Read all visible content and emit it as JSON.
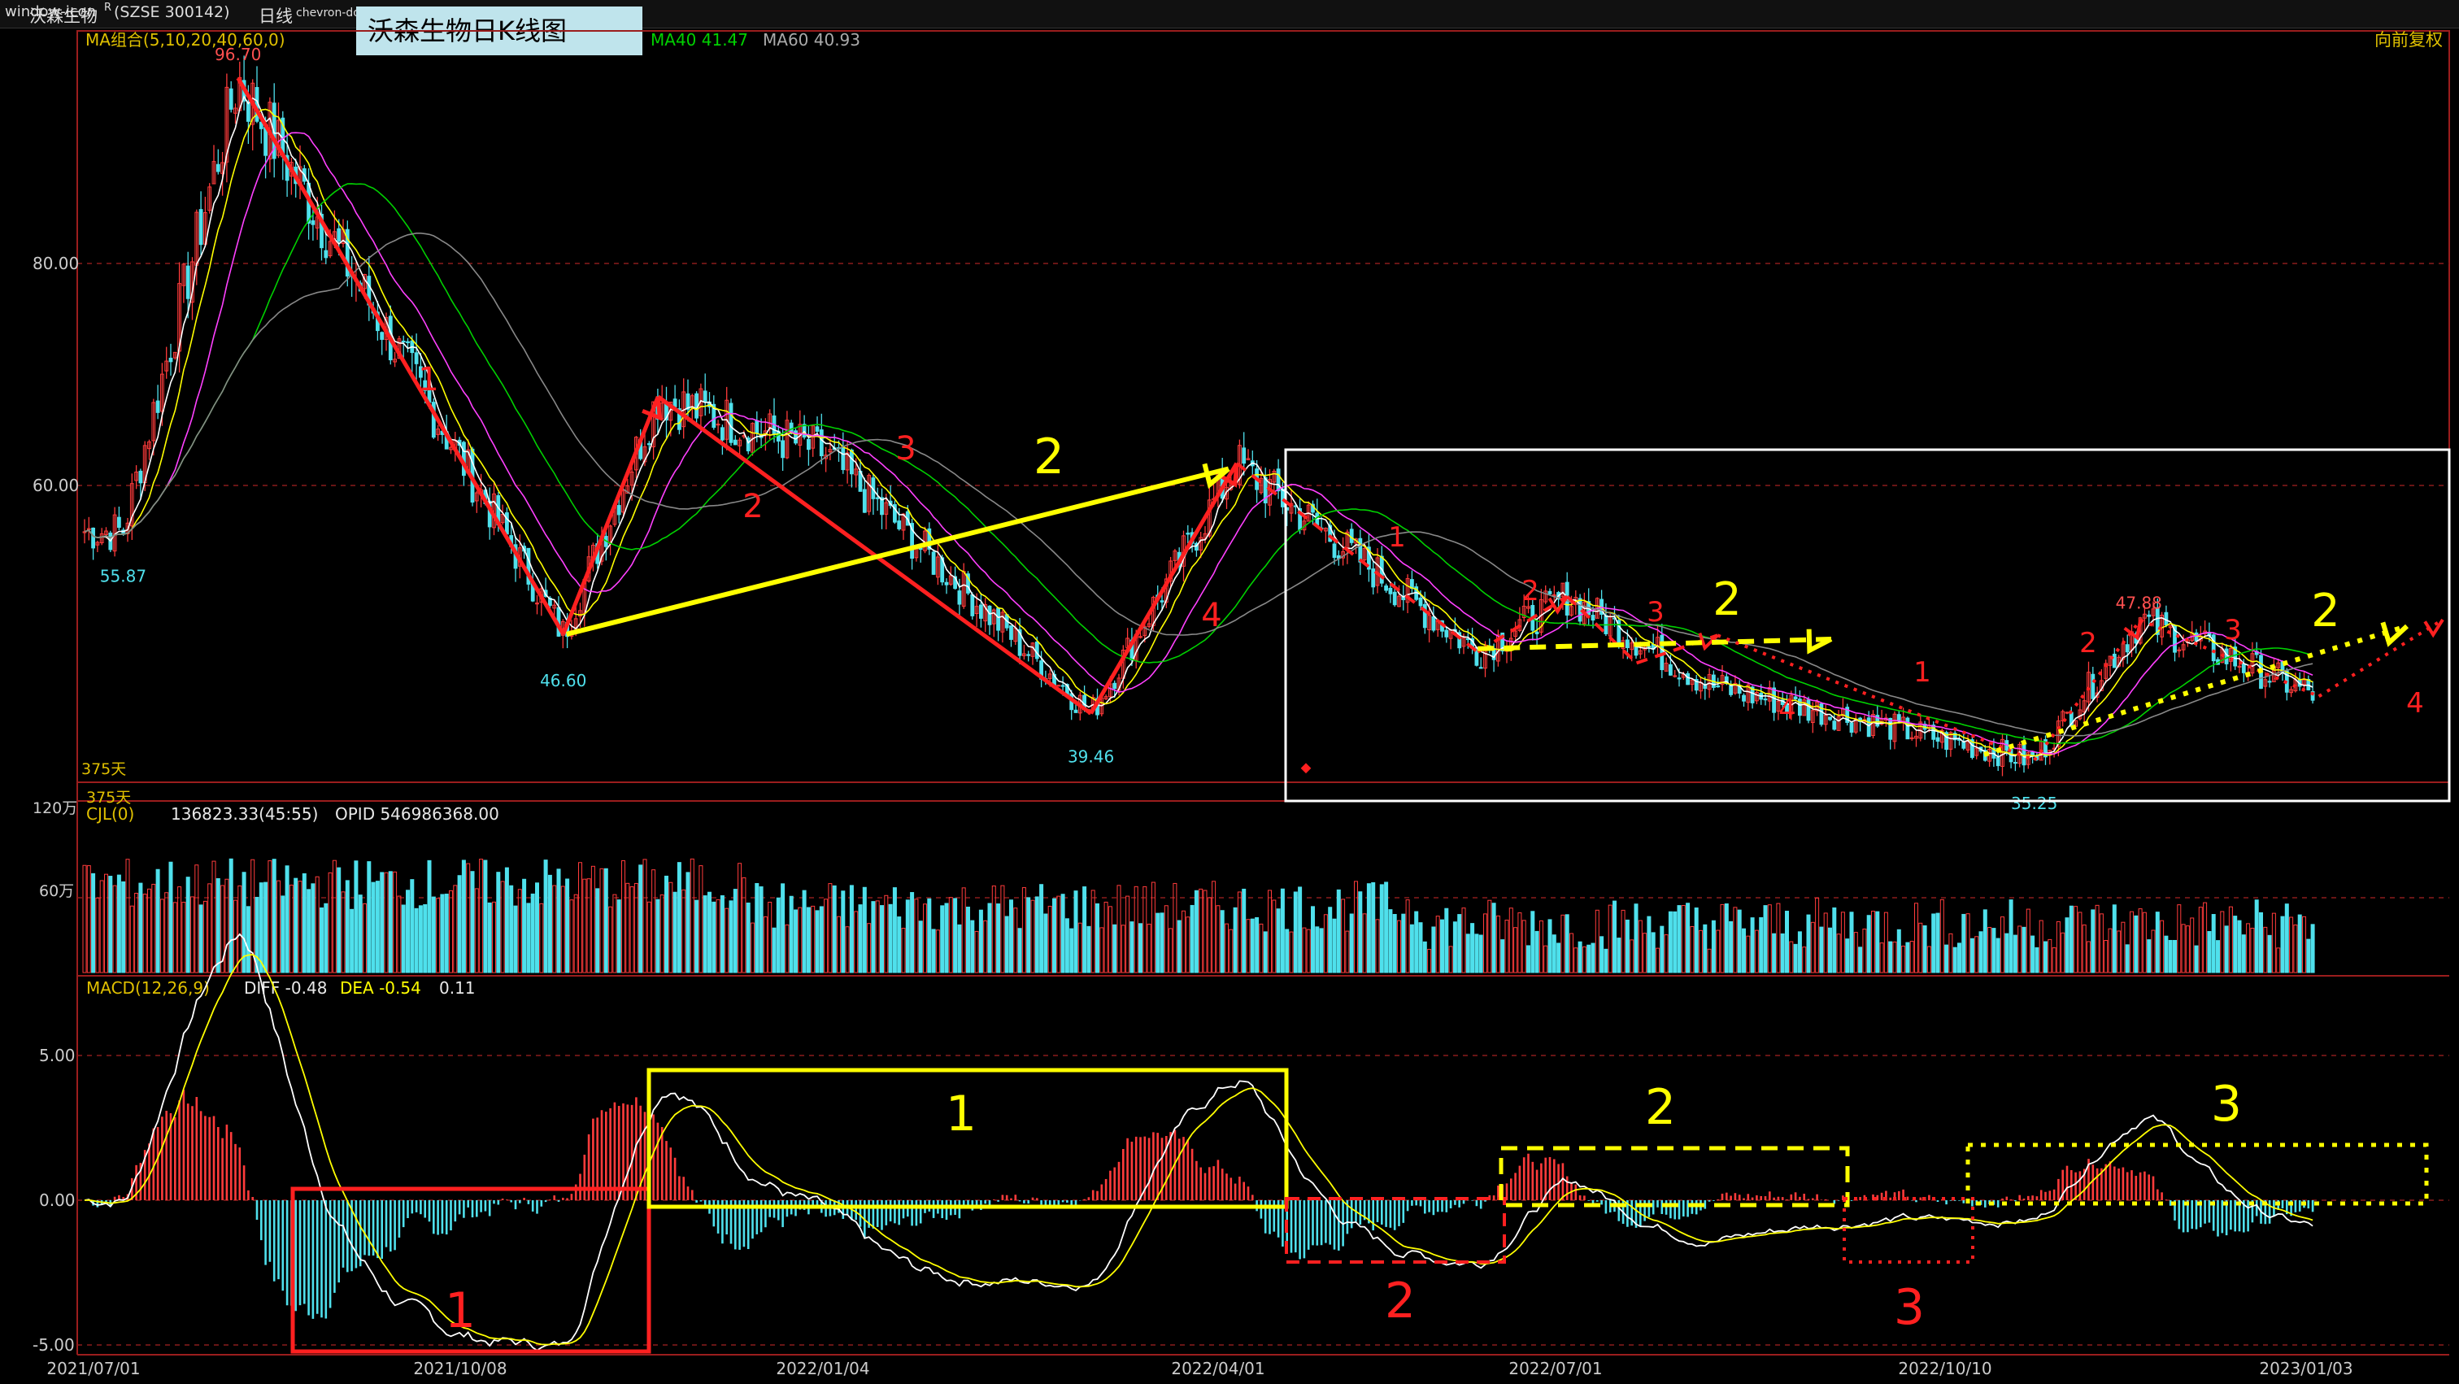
{
  "header": {
    "window_icon": "window-icon",
    "stock_name": "沃森生物",
    "r_mark": "R",
    "code": "(SZSE 300142)",
    "period": "日线",
    "period_icon": "chevron-down-icon",
    "title": "沃森生物日K线图"
  },
  "ma_legend": {
    "label": "MA组合(5,10,20,40,60,0)",
    "ma40": "MA40 41.47",
    "ma60": "MA60 40.93",
    "adjust": "向前复权"
  },
  "price_axis": [
    "80.00",
    "60.00"
  ],
  "price_labels": {
    "high": "96.70",
    "low1": "55.87",
    "low2": "46.60",
    "low3": "39.46",
    "low4": "35.25",
    "high2": "47.88",
    "days": "375天"
  },
  "volume_legend": {
    "label": "CJL(0)",
    "value": "136823.33(45:55)",
    "opid": "OPID 546986368.00",
    "axis": [
      "120万",
      "60万"
    ]
  },
  "macd_legend": {
    "label": "MACD(12,26,9)",
    "diff": "DIFF -0.48",
    "dea": "DEA -0.54",
    "macd": "0.11",
    "axis": [
      "5.00",
      "0.00",
      "-5.00"
    ]
  },
  "date_axis": [
    "2021/07/01",
    "2021/10/08",
    "2022/01/04",
    "2022/04/01",
    "2022/07/01",
    "2022/10/10",
    "2023/01/03"
  ],
  "annotations": {
    "wave_red": [
      "1",
      "2",
      "3",
      "4"
    ],
    "wave_big_2": "2",
    "sub_red": [
      "1",
      "2",
      "3",
      "4"
    ],
    "sub_yellow_2": "2",
    "sub2_red": [
      "1",
      "2",
      "3",
      "4"
    ],
    "sub2_yellow_2": "2",
    "macd_boxes": [
      "1",
      "1",
      "2",
      "2",
      "3",
      "3"
    ]
  },
  "chart_data": {
    "type": "candlestick",
    "title": "沃森生物日K线图",
    "x": [
      "2021/07/01",
      "2021/10/08",
      "2022/01/04",
      "2022/04/01",
      "2022/07/01",
      "2022/10/10",
      "2023/01/03"
    ],
    "ylim": [
      33,
      100
    ],
    "pivots": [
      {
        "date": "2021/07/09",
        "price": 55.87
      },
      {
        "date": "2021/08/09",
        "price": 96.7
      },
      {
        "date": "2021/11/02",
        "price": 46.6
      },
      {
        "date": "2021/11/25",
        "price": 68.0
      },
      {
        "date": "2022/01/04",
        "price": 63.0
      },
      {
        "date": "2022/03/04",
        "price": 39.46
      },
      {
        "date": "2022/04/06",
        "price": 62.0
      },
      {
        "date": "2022/06/10",
        "price": 45.0
      },
      {
        "date": "2022/07/04",
        "price": 50.0
      },
      {
        "date": "2022/08/10",
        "price": 42.0
      },
      {
        "date": "2022/10/31",
        "price": 35.25
      },
      {
        "date": "2022/11/25",
        "price": 47.88
      },
      {
        "date": "2023/01/06",
        "price": 41.0
      }
    ],
    "ma40": 41.47,
    "ma60": 40.93,
    "volume": {
      "label": "CJL(0)",
      "value": 136823.33,
      "opid": 546986368.0
    },
    "macd": {
      "diff": -0.48,
      "dea": -0.54,
      "macd": 0.11,
      "ylim": [
        -5.0,
        5.0
      ]
    }
  },
  "colors": {
    "up": "#ff3b3b",
    "down": "#4fe0ec",
    "ma5": "#ffffff",
    "ma10": "#ffff00",
    "ma20": "#ff40ff",
    "ma40": "#00d000",
    "ma60": "#888888",
    "annot_red": "#ff2020",
    "annot_yellow": "#ffff00"
  }
}
